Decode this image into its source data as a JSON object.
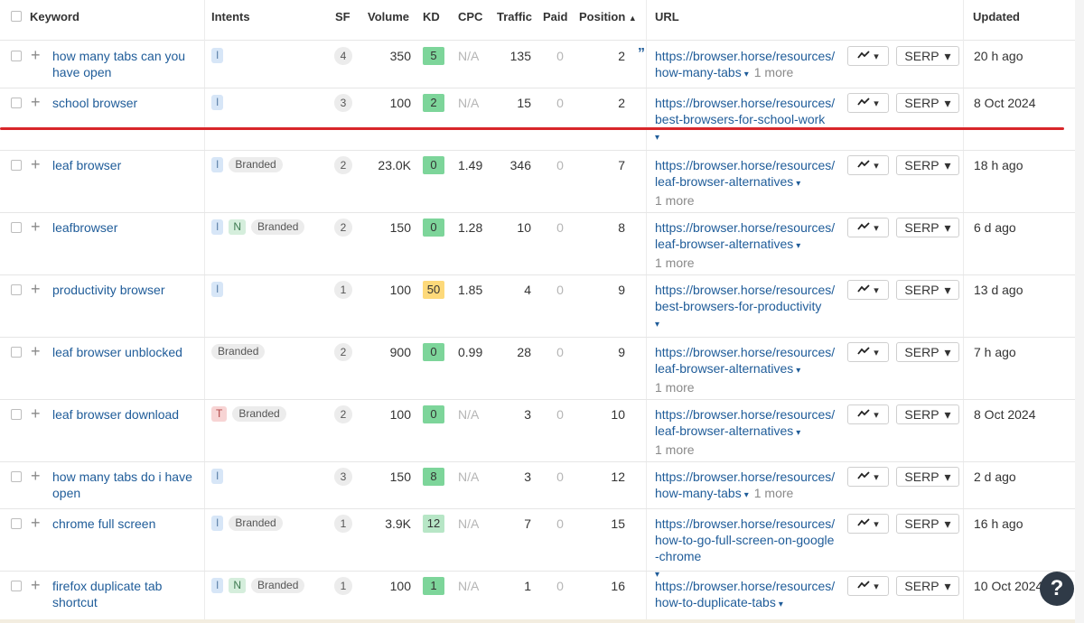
{
  "columns": {
    "keyword": "Keyword",
    "intents": "Intents",
    "sf": "SF",
    "volume": "Volume",
    "kd": "KD",
    "cpc": "CPC",
    "traffic": "Traffic",
    "paid": "Paid",
    "position": "Position",
    "position_sort": "▲",
    "url": "URL",
    "updated": "Updated"
  },
  "buttons": {
    "serp_label": "SERP",
    "chart_icon": "trend-line-icon",
    "caret": "▾"
  },
  "colors": {
    "kd_green": "#7dd59a",
    "kd_light_green": "#b7e6c6",
    "kd_yellow": "#fdd97a",
    "link": "#1f5c99",
    "highlight_line": "#d8262a"
  },
  "rows": [
    {
      "keyword": "how many tabs can you have open",
      "intents": [
        "I"
      ],
      "branded": false,
      "sf": "4",
      "volume": "350",
      "kd": "5",
      "kd_color": "#7dd59a",
      "cpc": "N/A",
      "traffic": "135",
      "paid": "0",
      "position": "2",
      "url_line1": "https://browser.horse/resources/",
      "url_line2": "how-many-tabs",
      "more": "1 more",
      "quote": true,
      "updated": "20 h ago"
    },
    {
      "keyword": "school browser",
      "intents": [
        "I"
      ],
      "branded": false,
      "sf": "3",
      "volume": "100",
      "kd": "2",
      "kd_color": "#7dd59a",
      "cpc": "N/A",
      "traffic": "15",
      "paid": "0",
      "position": "2",
      "url_line1": "https://browser.horse/resources/",
      "url_line2": "best-browsers-for-school-work",
      "more": "",
      "quote": false,
      "updated": "8 Oct 2024"
    },
    {
      "keyword": "leaf browser",
      "intents": [
        "I"
      ],
      "branded": true,
      "sf": "2",
      "volume": "23.0K",
      "kd": "0",
      "kd_color": "#7dd59a",
      "cpc": "1.49",
      "traffic": "346",
      "paid": "0",
      "position": "7",
      "url_line1": "https://browser.horse/resources/",
      "url_line2": "leaf-browser-alternatives",
      "more": "1 more",
      "quote": false,
      "updated": "18 h ago"
    },
    {
      "keyword": "leafbrowser",
      "intents": [
        "I",
        "N"
      ],
      "branded": true,
      "sf": "2",
      "volume": "150",
      "kd": "0",
      "kd_color": "#7dd59a",
      "cpc": "1.28",
      "traffic": "10",
      "paid": "0",
      "position": "8",
      "url_line1": "https://browser.horse/resources/",
      "url_line2": "leaf-browser-alternatives",
      "more": "1 more",
      "quote": false,
      "updated": "6 d ago"
    },
    {
      "keyword": "productivity browser",
      "intents": [
        "I"
      ],
      "branded": false,
      "sf": "1",
      "volume": "100",
      "kd": "50",
      "kd_color": "#fdd97a",
      "cpc": "1.85",
      "traffic": "4",
      "paid": "0",
      "position": "9",
      "url_line1": "https://browser.horse/resources/",
      "url_line2": "best-browsers-for-productivity",
      "more": "",
      "quote": false,
      "updated": "13 d ago"
    },
    {
      "keyword": "leaf browser unblocked",
      "intents": [],
      "branded": true,
      "sf": "2",
      "volume": "900",
      "kd": "0",
      "kd_color": "#7dd59a",
      "cpc": "0.99",
      "traffic": "28",
      "paid": "0",
      "position": "9",
      "url_line1": "https://browser.horse/resources/",
      "url_line2": "leaf-browser-alternatives",
      "more": "1 more",
      "quote": false,
      "updated": "7 h ago"
    },
    {
      "keyword": "leaf browser download",
      "intents": [
        "T"
      ],
      "branded": true,
      "sf": "2",
      "volume": "100",
      "kd": "0",
      "kd_color": "#7dd59a",
      "cpc": "N/A",
      "traffic": "3",
      "paid": "0",
      "position": "10",
      "url_line1": "https://browser.horse/resources/",
      "url_line2": "leaf-browser-alternatives",
      "more": "1 more",
      "quote": false,
      "updated": "8 Oct 2024"
    },
    {
      "keyword": "how many tabs do i have open",
      "intents": [
        "I"
      ],
      "branded": false,
      "sf": "3",
      "volume": "150",
      "kd": "8",
      "kd_color": "#7dd59a",
      "cpc": "N/A",
      "traffic": "3",
      "paid": "0",
      "position": "12",
      "url_line1": "https://browser.horse/resources/",
      "url_line2": "how-many-tabs",
      "more": "1 more",
      "quote": false,
      "updated": "2 d ago"
    },
    {
      "keyword": "chrome full screen",
      "intents": [
        "I"
      ],
      "branded": true,
      "sf": "1",
      "volume": "3.9K",
      "kd": "12",
      "kd_color": "#b7e6c6",
      "cpc": "N/A",
      "traffic": "7",
      "paid": "0",
      "position": "15",
      "url_line1": "https://browser.horse/resources/",
      "url_line2": "how-to-go-full-screen-on-google",
      "url_line3": "-chrome",
      "more": "",
      "quote": false,
      "updated": "16 h ago"
    },
    {
      "keyword": "firefox duplicate tab shortcut",
      "intents": [
        "I",
        "N"
      ],
      "branded": true,
      "sf": "1",
      "volume": "100",
      "kd": "1",
      "kd_color": "#7dd59a",
      "cpc": "N/A",
      "traffic": "1",
      "paid": "0",
      "position": "16",
      "url_line1": "https://browser.horse/resources/",
      "url_line2": "how-to-duplicate-tabs",
      "more": "",
      "quote": false,
      "updated": "10 Oct 2024"
    }
  ],
  "labels": {
    "branded": "Branded",
    "help": "?"
  }
}
